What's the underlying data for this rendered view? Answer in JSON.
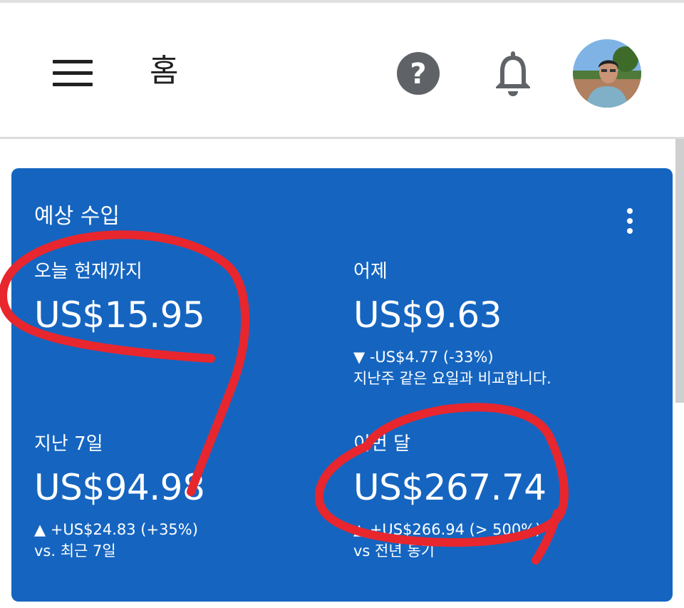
{
  "header": {
    "title": "홈",
    "icons": [
      "menu-icon",
      "help-icon",
      "notification-bell-icon",
      "avatar"
    ]
  },
  "card": {
    "title": "예상 수입",
    "today": {
      "label": "오늘 현재까지",
      "value": "US$15.95"
    },
    "yesterday": {
      "label": "어제",
      "value": "US$9.63",
      "change": "▼ -US$4.77 (-33%)",
      "note": "지난주 같은 요일과 비교합니다."
    },
    "last7": {
      "label": "지난 7일",
      "value": "US$94.98",
      "change": "▲ +US$24.83 (+35%)",
      "note": "vs. 최근 7일"
    },
    "thisMonth": {
      "label": "이번 달",
      "value": "US$267.74",
      "change": "▲ +US$266.94 (> 500%)",
      "note": "vs 전년 동기"
    }
  },
  "colors": {
    "card_background": "#1565c0",
    "annotation": "#e8262e",
    "icon": "#5f6368"
  }
}
